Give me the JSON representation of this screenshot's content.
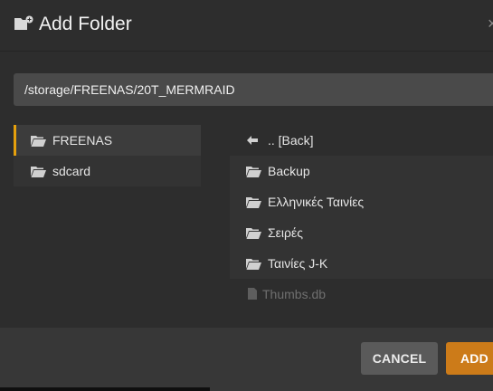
{
  "dialog": {
    "title": "Add Folder",
    "title_icon": "add-folder-icon",
    "close_icon": "close-icon",
    "close_glyph": "×"
  },
  "path_input": {
    "value": "/storage/FREENAS/20T_MERMRAID"
  },
  "sources": [
    {
      "label": "FREENAS",
      "icon": "folder-open-icon",
      "selected": true
    },
    {
      "label": "sdcard",
      "icon": "folder-open-icon",
      "selected": false
    }
  ],
  "entries": [
    {
      "label": ".. [Back]",
      "icon": "back-arrow-icon",
      "type": "back"
    },
    {
      "label": "Backup",
      "icon": "folder-open-icon",
      "type": "folder"
    },
    {
      "label": "Ελληνικές Ταινίες",
      "icon": "folder-open-icon",
      "type": "folder"
    },
    {
      "label": "Σειρές",
      "icon": "folder-open-icon",
      "type": "folder"
    },
    {
      "label": "Ταινίες J-K",
      "icon": "folder-open-icon",
      "type": "folder"
    },
    {
      "label": "Thumbs.db",
      "icon": "file-icon",
      "type": "file"
    }
  ],
  "buttons": {
    "cancel_label": "CANCEL",
    "add_label": "ADD"
  },
  "colors": {
    "accent": "#e5a00d",
    "add_button": "#cc7b19",
    "cancel_button": "#5a5a5a",
    "dialog_bg": "#2d2d2d",
    "footer_bg": "#373737"
  }
}
